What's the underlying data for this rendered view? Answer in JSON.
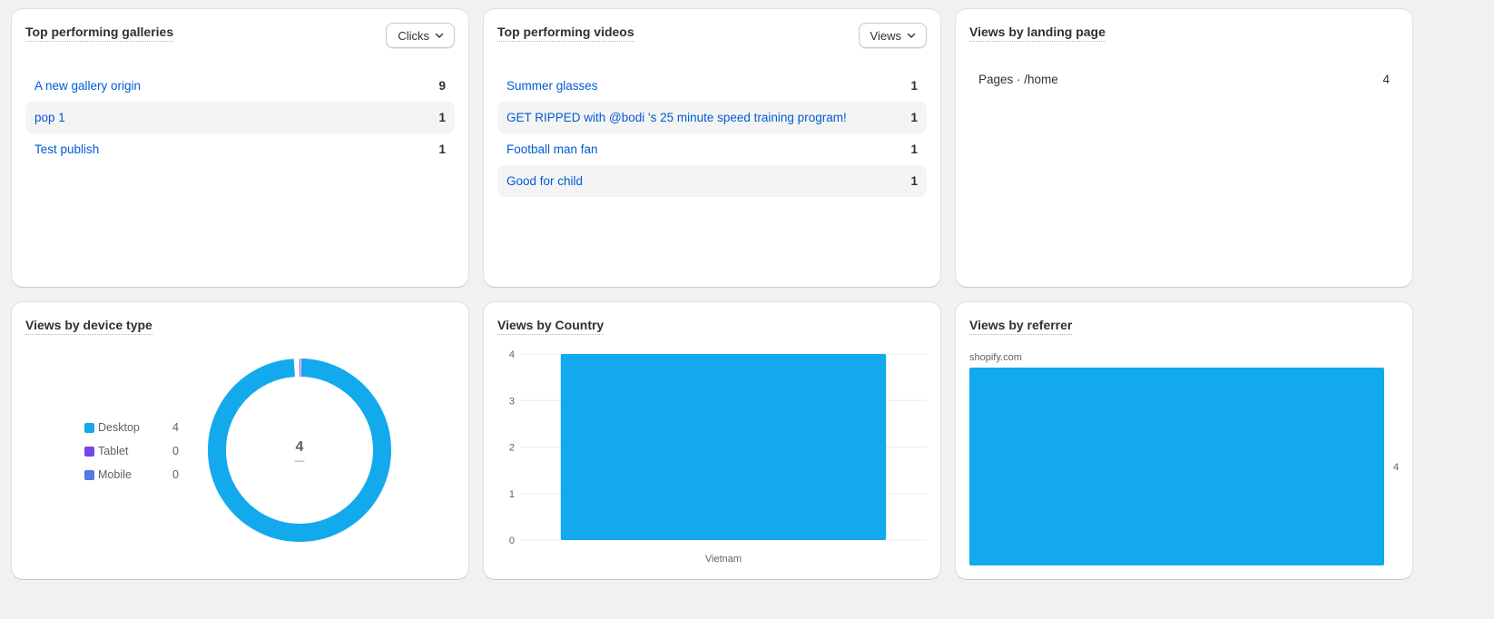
{
  "galleries": {
    "title": "Top performing galleries",
    "sort_label": "Clicks",
    "rows": [
      {
        "name": "A new gallery origin",
        "count": "9"
      },
      {
        "name": "pop 1",
        "count": "1"
      },
      {
        "name": "Test publish",
        "count": "1"
      }
    ]
  },
  "videos": {
    "title": "Top performing videos",
    "sort_label": "Views",
    "rows": [
      {
        "name": "Summer glasses",
        "count": "1"
      },
      {
        "name": "GET RIPPED with @bodi 's 25 minute speed training program!",
        "count": "1"
      },
      {
        "name": "Football man fan",
        "count": "1"
      },
      {
        "name": "Good for child",
        "count": "1"
      }
    ]
  },
  "landing": {
    "title": "Views by landing page",
    "rows": [
      {
        "name": "Pages · /home",
        "count": "4"
      }
    ]
  },
  "device": {
    "title": "Views by device type",
    "total": "4",
    "total_sub": "—",
    "legend": [
      {
        "label": "Desktop",
        "value": "4",
        "color": "#13a9ed"
      },
      {
        "label": "Tablet",
        "value": "0",
        "color": "#7646ec"
      },
      {
        "label": "Mobile",
        "value": "0",
        "color": "#5578e6"
      }
    ]
  },
  "country": {
    "title": "Views by Country"
  },
  "referrer": {
    "title": "Views by referrer"
  },
  "chart_data": [
    {
      "type": "pie",
      "title": "Views by device type",
      "categories": [
        "Desktop",
        "Tablet",
        "Mobile"
      ],
      "values": [
        4,
        0,
        0
      ]
    },
    {
      "type": "bar",
      "title": "Views by Country",
      "categories": [
        "Vietnam"
      ],
      "values": [
        4
      ],
      "ylim": [
        0,
        4
      ],
      "yticks": [
        0,
        1,
        2,
        3,
        4
      ],
      "grid": true,
      "color": "#13a9ed"
    },
    {
      "type": "bar",
      "orientation": "horizontal",
      "title": "Views by referrer",
      "categories": [
        "shopify.com"
      ],
      "values": [
        4
      ],
      "xlim": [
        0,
        4
      ],
      "color": "#13a9ed"
    }
  ]
}
